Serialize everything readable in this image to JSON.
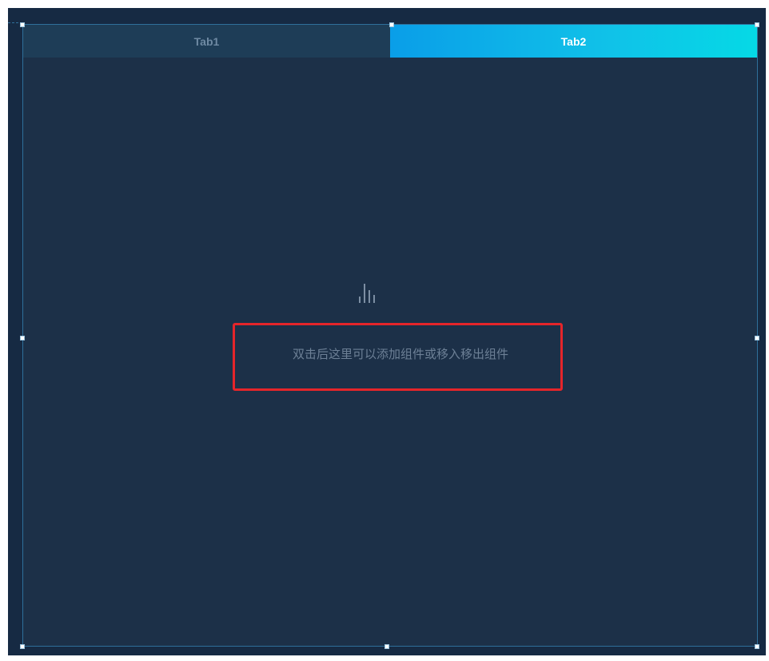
{
  "tabs": [
    {
      "label": "Tab1",
      "active": false
    },
    {
      "label": "Tab2",
      "active": true
    }
  ],
  "placeholder": {
    "text": "双击后这里可以添加组件或移入移出组件",
    "icon": "bar-chart-icon"
  },
  "colors": {
    "canvas_background": "#162a43",
    "component_background": "#1c3048",
    "active_tab_gradient_start": "#0a9ee8",
    "active_tab_gradient_end": "#05d9e6",
    "inactive_tab": "#1e3d57",
    "highlight_border": "#e5252a"
  }
}
